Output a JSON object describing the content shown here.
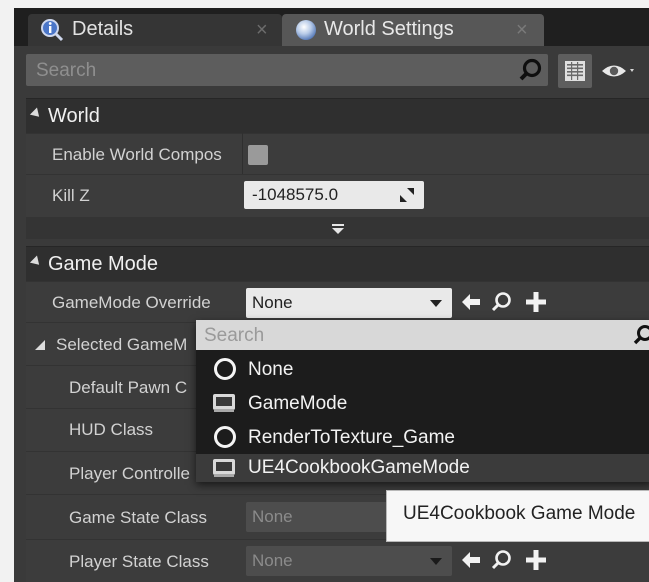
{
  "tabs": [
    {
      "label": "Details",
      "icon": "magnifier-info-icon",
      "close": "×"
    },
    {
      "label": "World Settings",
      "icon": "globe-icon",
      "close": "×"
    }
  ],
  "search": {
    "placeholder": "Search",
    "value": ""
  },
  "world": {
    "header": "World",
    "enable_world_composition_label": "Enable World Compos",
    "enable_world_composition_checked": false,
    "kill_z_label": "Kill Z",
    "kill_z_value": "-1048575.0"
  },
  "game_mode": {
    "header": "Game Mode",
    "override_label": "GameMode Override",
    "override_value": "None",
    "selected_label": "Selected GameM",
    "default_pawn_label": "Default Pawn C",
    "hud_label": "HUD Class",
    "player_controller_label": "Player Controlle",
    "game_state_label": "Game State Class",
    "game_state_value": "None",
    "player_state_label": "Player State Class",
    "player_state_value": "None"
  },
  "dropdown": {
    "search_placeholder": "Search",
    "items": [
      {
        "label": "None",
        "icon": "circle-icon"
      },
      {
        "label": "GameMode",
        "icon": "blueprint-icon"
      },
      {
        "label": "RenderToTexture_Game",
        "icon": "circle-icon"
      },
      {
        "label": "UE4CookbookGameMode",
        "icon": "blueprint-icon"
      }
    ],
    "highlighted_index": 3
  },
  "tooltip": {
    "text": "UE4Cookbook Game Mode"
  },
  "colors": {
    "panel": "#3a3a3a",
    "header": "#2f2f2f",
    "dropdown_bg": "#1c1c1c",
    "accent_blue": "#4a84c6"
  }
}
